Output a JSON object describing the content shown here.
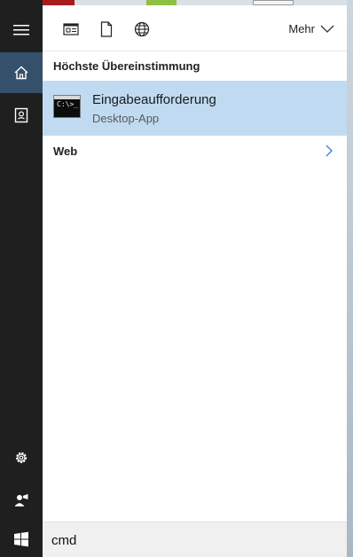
{
  "filter_bar": {
    "icons": [
      "apps-filter-icon",
      "documents-filter-icon",
      "web-filter-icon"
    ],
    "more_label": "Mehr"
  },
  "best_match": {
    "heading": "Höchste Übereinstimmung",
    "result": {
      "title": "Eingabeaufforderung",
      "subtitle": "Desktop-App",
      "icon": "command-prompt-icon",
      "icon_text": "C:\\>_"
    }
  },
  "web": {
    "label": "Web"
  },
  "search": {
    "value": "cmd"
  },
  "rail": {
    "icons": [
      "hamburger-menu-icon",
      "home-icon",
      "notebook-icon",
      "settings-gear-icon",
      "feedback-icon",
      "windows-start-icon"
    ]
  },
  "colors": {
    "rail_bg": "#1f1f1f",
    "rail_active": "#34506b",
    "selected_result": "#c0dbf1",
    "search_bg": "#f0f0f0"
  }
}
